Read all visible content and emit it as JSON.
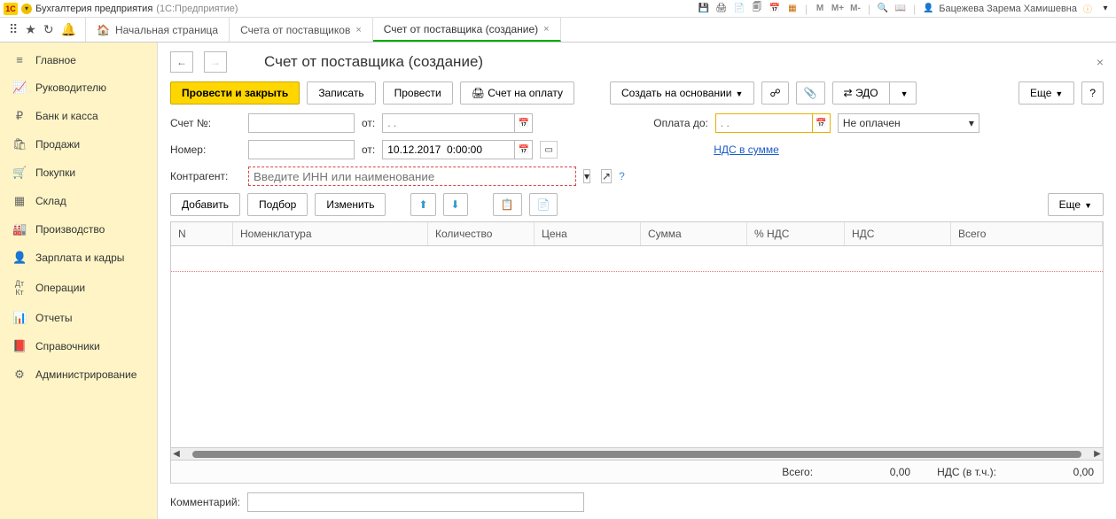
{
  "titlebar": {
    "app": "Бухгалтерия предприятия",
    "sub": "(1С:Предприятие)",
    "user": "Бацежева Зарема Хамишевна",
    "m_labels": [
      "M",
      "M+",
      "M-"
    ]
  },
  "tabs": {
    "home": "Начальная страница",
    "t1": "Счета от поставщиков",
    "t2": "Счет от поставщика (создание)"
  },
  "sidebar": {
    "items": [
      {
        "icon": "≡",
        "label": "Главное"
      },
      {
        "icon": "📈",
        "label": "Руководителю"
      },
      {
        "icon": "₽",
        "label": "Банк и касса"
      },
      {
        "icon": "🛍",
        "label": "Продажи"
      },
      {
        "icon": "🛒",
        "label": "Покупки"
      },
      {
        "icon": "▦",
        "label": "Склад"
      },
      {
        "icon": "🏭",
        "label": "Производство"
      },
      {
        "icon": "👤",
        "label": "Зарплата и кадры"
      },
      {
        "icon": "Дт",
        "label": "Операции"
      },
      {
        "icon": "📊",
        "label": "Отчеты"
      },
      {
        "icon": "📕",
        "label": "Справочники"
      },
      {
        "icon": "⚙",
        "label": "Администрирование"
      }
    ]
  },
  "page": {
    "title": "Счет от поставщика (создание)"
  },
  "toolbar": {
    "post_close": "Провести и закрыть",
    "write": "Записать",
    "post": "Провести",
    "invoice": "Счет на оплату",
    "create_based": "Создать на основании",
    "edo": "ЭДО",
    "more": "Еще"
  },
  "form": {
    "account_no_label": "Счет №:",
    "from_label": "от:",
    "date_placeholder": ". .",
    "pay_until_label": "Оплата до:",
    "pay_status": "Не оплачен",
    "number_label": "Номер:",
    "datetime": "10.12.2017  0:00:00",
    "vat_link": "НДС в сумме",
    "counterparty_label": "Контрагент:",
    "counterparty_placeholder": "Введите ИНН или наименование"
  },
  "table_toolbar": {
    "add": "Добавить",
    "pick": "Подбор",
    "edit": "Изменить",
    "more": "Еще"
  },
  "table": {
    "headers": [
      "N",
      "Номенклатура",
      "Количество",
      "Цена",
      "Сумма",
      "% НДС",
      "НДС",
      "Всего"
    ]
  },
  "totals": {
    "total_label": "Всего:",
    "total_value": "0,00",
    "vat_label": "НДС (в т.ч.):",
    "vat_value": "0,00"
  },
  "comment": {
    "label": "Комментарий:"
  }
}
